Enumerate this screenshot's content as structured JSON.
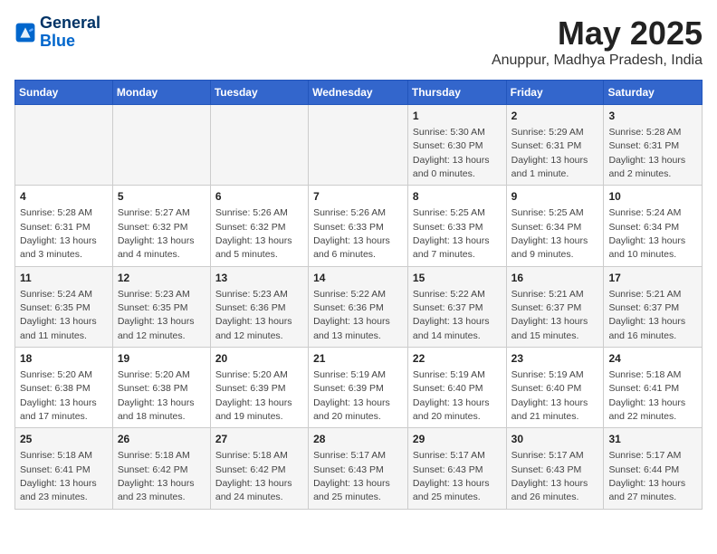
{
  "logo": {
    "line1": "General",
    "line2": "Blue"
  },
  "title": {
    "month": "May 2025",
    "location": "Anuppur, Madhya Pradesh, India"
  },
  "days_of_week": [
    "Sunday",
    "Monday",
    "Tuesday",
    "Wednesday",
    "Thursday",
    "Friday",
    "Saturday"
  ],
  "weeks": [
    [
      {
        "day": "",
        "detail": ""
      },
      {
        "day": "",
        "detail": ""
      },
      {
        "day": "",
        "detail": ""
      },
      {
        "day": "",
        "detail": ""
      },
      {
        "day": "1",
        "detail": "Sunrise: 5:30 AM\nSunset: 6:30 PM\nDaylight: 13 hours\nand 0 minutes."
      },
      {
        "day": "2",
        "detail": "Sunrise: 5:29 AM\nSunset: 6:31 PM\nDaylight: 13 hours\nand 1 minute."
      },
      {
        "day": "3",
        "detail": "Sunrise: 5:28 AM\nSunset: 6:31 PM\nDaylight: 13 hours\nand 2 minutes."
      }
    ],
    [
      {
        "day": "4",
        "detail": "Sunrise: 5:28 AM\nSunset: 6:31 PM\nDaylight: 13 hours\nand 3 minutes."
      },
      {
        "day": "5",
        "detail": "Sunrise: 5:27 AM\nSunset: 6:32 PM\nDaylight: 13 hours\nand 4 minutes."
      },
      {
        "day": "6",
        "detail": "Sunrise: 5:26 AM\nSunset: 6:32 PM\nDaylight: 13 hours\nand 5 minutes."
      },
      {
        "day": "7",
        "detail": "Sunrise: 5:26 AM\nSunset: 6:33 PM\nDaylight: 13 hours\nand 6 minutes."
      },
      {
        "day": "8",
        "detail": "Sunrise: 5:25 AM\nSunset: 6:33 PM\nDaylight: 13 hours\nand 7 minutes."
      },
      {
        "day": "9",
        "detail": "Sunrise: 5:25 AM\nSunset: 6:34 PM\nDaylight: 13 hours\nand 9 minutes."
      },
      {
        "day": "10",
        "detail": "Sunrise: 5:24 AM\nSunset: 6:34 PM\nDaylight: 13 hours\nand 10 minutes."
      }
    ],
    [
      {
        "day": "11",
        "detail": "Sunrise: 5:24 AM\nSunset: 6:35 PM\nDaylight: 13 hours\nand 11 minutes."
      },
      {
        "day": "12",
        "detail": "Sunrise: 5:23 AM\nSunset: 6:35 PM\nDaylight: 13 hours\nand 12 minutes."
      },
      {
        "day": "13",
        "detail": "Sunrise: 5:23 AM\nSunset: 6:36 PM\nDaylight: 13 hours\nand 12 minutes."
      },
      {
        "day": "14",
        "detail": "Sunrise: 5:22 AM\nSunset: 6:36 PM\nDaylight: 13 hours\nand 13 minutes."
      },
      {
        "day": "15",
        "detail": "Sunrise: 5:22 AM\nSunset: 6:37 PM\nDaylight: 13 hours\nand 14 minutes."
      },
      {
        "day": "16",
        "detail": "Sunrise: 5:21 AM\nSunset: 6:37 PM\nDaylight: 13 hours\nand 15 minutes."
      },
      {
        "day": "17",
        "detail": "Sunrise: 5:21 AM\nSunset: 6:37 PM\nDaylight: 13 hours\nand 16 minutes."
      }
    ],
    [
      {
        "day": "18",
        "detail": "Sunrise: 5:20 AM\nSunset: 6:38 PM\nDaylight: 13 hours\nand 17 minutes."
      },
      {
        "day": "19",
        "detail": "Sunrise: 5:20 AM\nSunset: 6:38 PM\nDaylight: 13 hours\nand 18 minutes."
      },
      {
        "day": "20",
        "detail": "Sunrise: 5:20 AM\nSunset: 6:39 PM\nDaylight: 13 hours\nand 19 minutes."
      },
      {
        "day": "21",
        "detail": "Sunrise: 5:19 AM\nSunset: 6:39 PM\nDaylight: 13 hours\nand 20 minutes."
      },
      {
        "day": "22",
        "detail": "Sunrise: 5:19 AM\nSunset: 6:40 PM\nDaylight: 13 hours\nand 20 minutes."
      },
      {
        "day": "23",
        "detail": "Sunrise: 5:19 AM\nSunset: 6:40 PM\nDaylight: 13 hours\nand 21 minutes."
      },
      {
        "day": "24",
        "detail": "Sunrise: 5:18 AM\nSunset: 6:41 PM\nDaylight: 13 hours\nand 22 minutes."
      }
    ],
    [
      {
        "day": "25",
        "detail": "Sunrise: 5:18 AM\nSunset: 6:41 PM\nDaylight: 13 hours\nand 23 minutes."
      },
      {
        "day": "26",
        "detail": "Sunrise: 5:18 AM\nSunset: 6:42 PM\nDaylight: 13 hours\nand 23 minutes."
      },
      {
        "day": "27",
        "detail": "Sunrise: 5:18 AM\nSunset: 6:42 PM\nDaylight: 13 hours\nand 24 minutes."
      },
      {
        "day": "28",
        "detail": "Sunrise: 5:17 AM\nSunset: 6:43 PM\nDaylight: 13 hours\nand 25 minutes."
      },
      {
        "day": "29",
        "detail": "Sunrise: 5:17 AM\nSunset: 6:43 PM\nDaylight: 13 hours\nand 25 minutes."
      },
      {
        "day": "30",
        "detail": "Sunrise: 5:17 AM\nSunset: 6:43 PM\nDaylight: 13 hours\nand 26 minutes."
      },
      {
        "day": "31",
        "detail": "Sunrise: 5:17 AM\nSunset: 6:44 PM\nDaylight: 13 hours\nand 27 minutes."
      }
    ]
  ]
}
